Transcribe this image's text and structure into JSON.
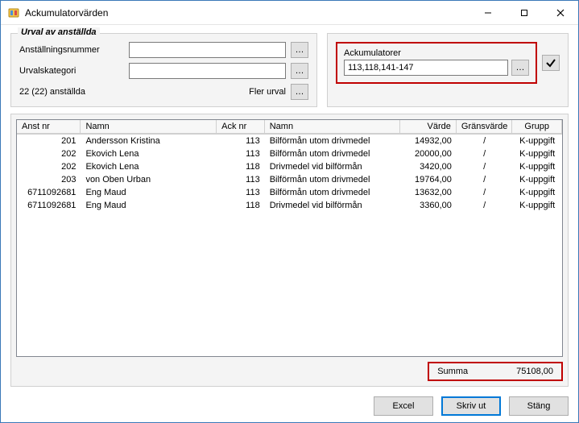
{
  "window": {
    "title": "Ackumulatorvärden"
  },
  "selection": {
    "legend": "Urval av anställda",
    "anstallningsnummer_label": "Anställningsnummer",
    "anstallningsnummer_value": "",
    "urvalskategori_label": "Urvalskategori",
    "urvalskategori_value": "",
    "count_text": "22 (22) anställda",
    "more_label": "Fler urval"
  },
  "ackumulatorer": {
    "label": "Ackumulatorer",
    "value": "113,118,141-147"
  },
  "table": {
    "headers": {
      "anst_nr": "Anst nr",
      "namn1": "Namn",
      "ack_nr": "Ack nr",
      "namn2": "Namn",
      "varde": "Värde",
      "gransvarde": "Gränsvärde",
      "grupp": "Grupp"
    },
    "rows": [
      {
        "anst_nr": "201",
        "namn1": "Andersson Kristina",
        "ack_nr": "113",
        "namn2": "Bilförmån utom drivmedel",
        "varde": "14932,00",
        "grans": "/",
        "grupp": "K-uppgift"
      },
      {
        "anst_nr": "202",
        "namn1": "Ekovich Lena",
        "ack_nr": "113",
        "namn2": "Bilförmån utom drivmedel",
        "varde": "20000,00",
        "grans": "/",
        "grupp": "K-uppgift"
      },
      {
        "anst_nr": "202",
        "namn1": "Ekovich Lena",
        "ack_nr": "118",
        "namn2": "Drivmedel vid bilförmån",
        "varde": "3420,00",
        "grans": "/",
        "grupp": "K-uppgift"
      },
      {
        "anst_nr": "203",
        "namn1": "von Oben Urban",
        "ack_nr": "113",
        "namn2": "Bilförmån utom drivmedel",
        "varde": "19764,00",
        "grans": "/",
        "grupp": "K-uppgift"
      },
      {
        "anst_nr": "6711092681",
        "namn1": "Eng Maud",
        "ack_nr": "113",
        "namn2": "Bilförmån utom drivmedel",
        "varde": "13632,00",
        "grans": "/",
        "grupp": "K-uppgift"
      },
      {
        "anst_nr": "6711092681",
        "namn1": "Eng Maud",
        "ack_nr": "118",
        "namn2": "Drivmedel vid bilförmån",
        "varde": "3360,00",
        "grans": "/",
        "grupp": "K-uppgift"
      }
    ]
  },
  "summa": {
    "label": "Summa",
    "value": "75108,00"
  },
  "buttons": {
    "excel": "Excel",
    "print": "Skriv ut",
    "close": "Stäng"
  }
}
